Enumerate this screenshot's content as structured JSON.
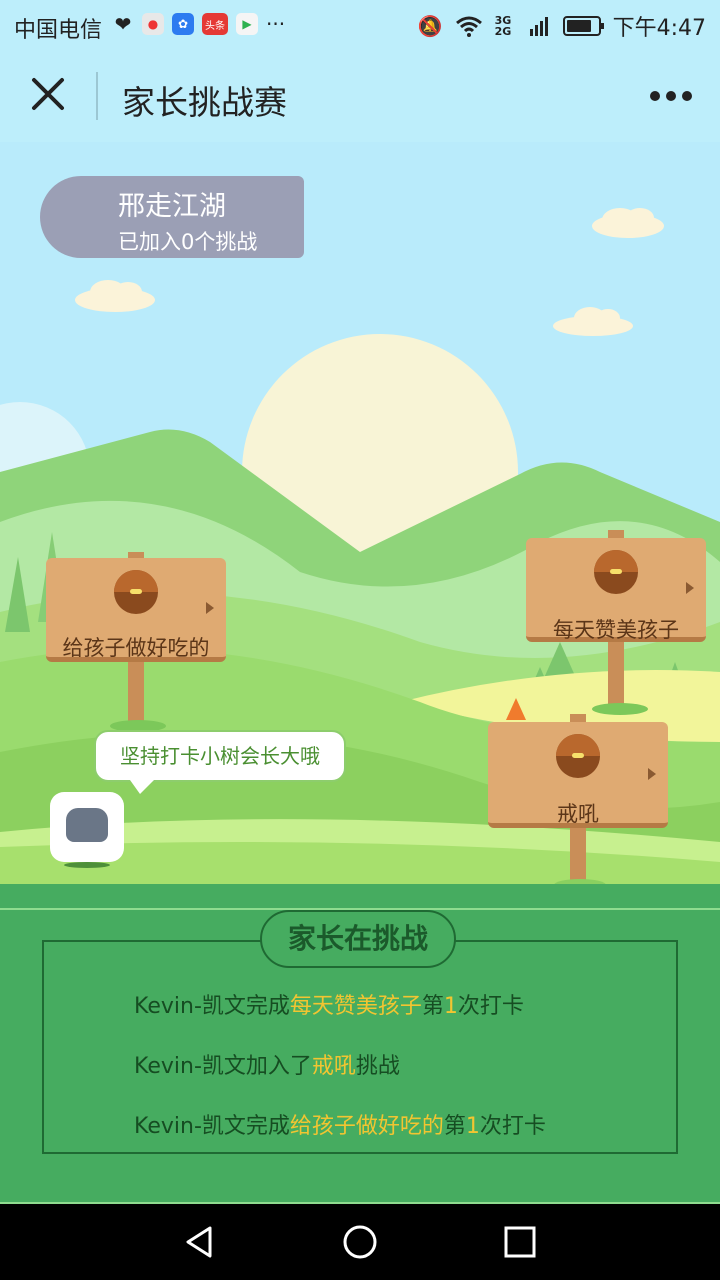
{
  "status_bar": {
    "carrier": "中国电信",
    "notification_icons": [
      "heart-rate-icon",
      "map-pin-icon",
      "paw-icon",
      "news-icon",
      "video-play-icon"
    ],
    "news_icon_text": "头条",
    "more_notifications": "···",
    "time": "下午4:47",
    "network": "3G 2G",
    "status_icons": [
      "mute-icon",
      "wifi-icon",
      "signal-icon",
      "battery-icon"
    ]
  },
  "nav": {
    "title": "家长挑战赛",
    "close_icon": "close-icon",
    "more_icon": "more-icon"
  },
  "user": {
    "name": "邢走江湖",
    "joined": "已加入0个挑战"
  },
  "signs": [
    {
      "label": "给孩子做好吃的"
    },
    {
      "label": "每天赞美孩子"
    },
    {
      "label": "戒吼"
    }
  ],
  "speech_bubble": "坚持打卡小树会长大哦",
  "panel": {
    "heading": "家长在挑战",
    "feed": [
      {
        "pre": "Kevin-凯文完成",
        "hl": "每天赞美孩子",
        "mid": "第",
        "num": "1",
        "post": "次打卡"
      },
      {
        "pre": "Kevin-凯文加入了",
        "hl": "戒吼",
        "mid": "",
        "num": "",
        "post": "挑战"
      },
      {
        "pre": "Kevin-凯文完成",
        "hl": "给孩子做好吃的",
        "mid": "第",
        "num": "1",
        "post": "次打卡"
      }
    ]
  },
  "colors": {
    "sky": "#bdeefb",
    "panel_green": "#46ac60",
    "highlight": "#f2c531",
    "sign_wood": "#dfaa72",
    "user_pill": "#9b9fb5"
  },
  "system_nav": [
    "back-icon",
    "home-icon",
    "recents-icon"
  ]
}
